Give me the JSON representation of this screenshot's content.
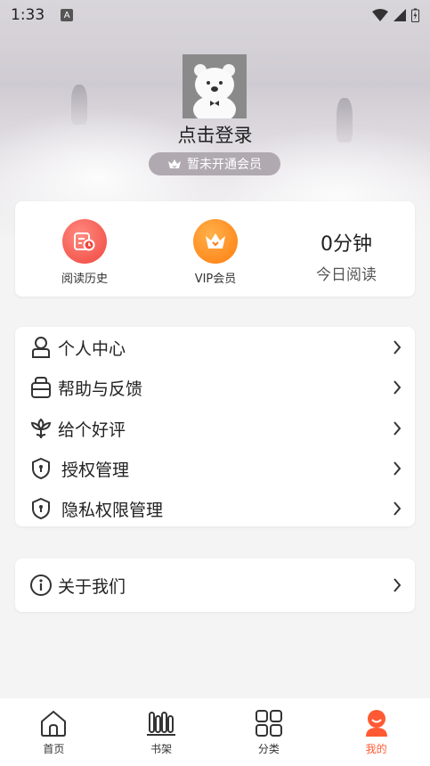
{
  "status_bar": {
    "time": "1:33",
    "badge": "A"
  },
  "profile": {
    "login_text": "点击登录",
    "vip_status": "暂未开通会员"
  },
  "stats": {
    "history_label": "阅读历史",
    "vip_label": "VIP会员",
    "today_value": "0分钟",
    "today_label": "今日阅读"
  },
  "menu": {
    "items": [
      {
        "label": "个人中心",
        "icon": "person-icon"
      },
      {
        "label": "帮助与反馈",
        "icon": "help-icon"
      },
      {
        "label": "给个好评",
        "icon": "flower-icon"
      },
      {
        "label": "授权管理",
        "icon": "shield-icon"
      },
      {
        "label": "隐私权限管理",
        "icon": "shield-icon"
      }
    ]
  },
  "about": {
    "label": "关于我们",
    "icon": "info-icon"
  },
  "bottom_nav": {
    "items": [
      {
        "label": "首页",
        "icon": "home-icon"
      },
      {
        "label": "书架",
        "icon": "bookshelf-icon"
      },
      {
        "label": "分类",
        "icon": "grid-icon"
      },
      {
        "label": "我的",
        "icon": "user-icon",
        "active": true
      }
    ]
  },
  "colors": {
    "accent": "#ff5a33",
    "history_icon": "#f0463d",
    "vip_icon": "#ff7d0f"
  }
}
